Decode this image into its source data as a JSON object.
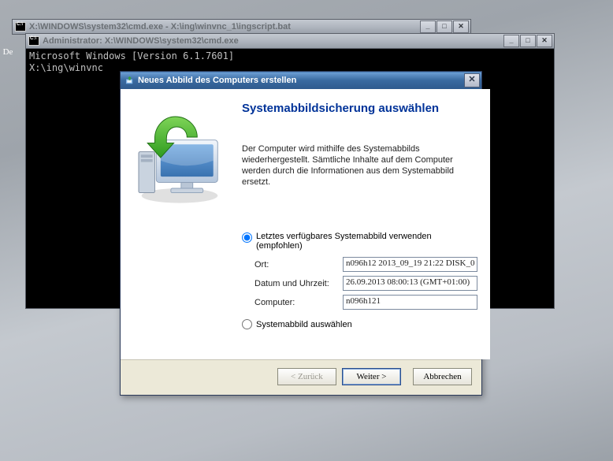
{
  "cmd1": {
    "title": "X:\\WINDOWS\\system32\\cmd.exe - X:\\ing\\winvnc_1\\ingscript.bat"
  },
  "cmd2": {
    "title": "Administrator: X:\\WINDOWS\\system32\\cmd.exe",
    "line1": "Microsoft Windows [Version 6.1.7601]",
    "line2": "",
    "line3": "X:\\ing\\winvnc"
  },
  "desktop": {
    "label": "De"
  },
  "wizard": {
    "title": "Neues Abbild des Computers erstellen",
    "heading": "Systemabbildsicherung auswählen",
    "description": "Der Computer wird mithilfe des Systemabbilds wiederhergestellt. Sämtliche Inhalte auf dem Computer werden durch die Informationen aus dem Systemabbild ersetzt.",
    "option1": "Letztes verfügbares Systemabbild verwenden (empfohlen)",
    "field_ort_label": "Ort:",
    "field_ort_value": "n096h12 2013_09_19 21:22 DISK_0",
    "field_datum_label": "Datum und Uhrzeit:",
    "field_datum_value": "26.09.2013 08:00:13 (GMT+01:00)",
    "field_computer_label": "Computer:",
    "field_computer_value": "n096h121",
    "option2": "Systemabbild auswählen",
    "btn_back": "< Zurück",
    "btn_next": "Weiter >",
    "btn_cancel": "Abbrechen"
  },
  "win_controls": {
    "min": "_",
    "max": "□",
    "close": "✕"
  }
}
